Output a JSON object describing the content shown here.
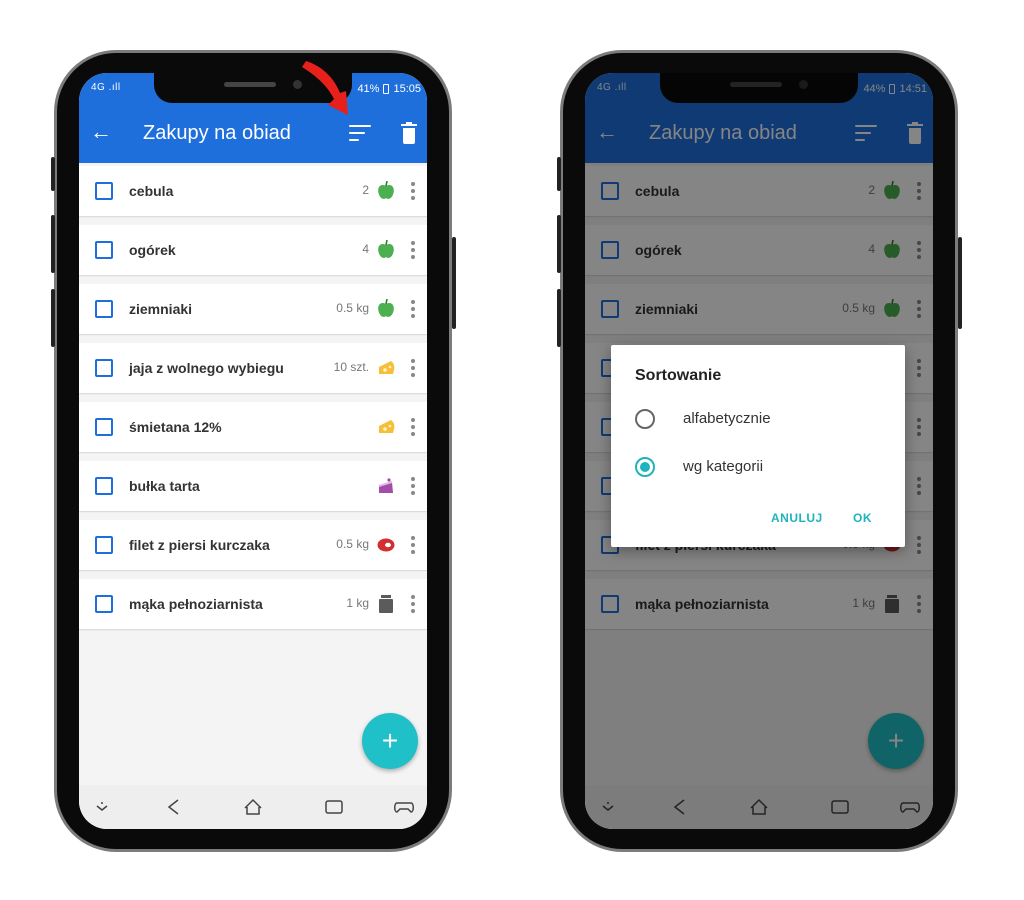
{
  "status_left": {
    "time": "15:05",
    "battery": "41%",
    "network": "4G"
  },
  "status_right": {
    "time": "14:51",
    "battery": "44%",
    "network": "4G"
  },
  "appbar": {
    "title": "Zakupy na obiad"
  },
  "items": [
    {
      "name": "cebula",
      "qty": "2",
      "category": "apple-icon",
      "color": "#4caf50"
    },
    {
      "name": "ogórek",
      "qty": "4",
      "category": "apple-icon",
      "color": "#4caf50"
    },
    {
      "name": "ziemniaki",
      "qty": "0.5 kg",
      "category": "apple-icon",
      "color": "#4caf50"
    },
    {
      "name": "jaja z wolnego wybiegu",
      "qty": "10 szt.",
      "category": "cheese-icon",
      "color": "#f6bf3a"
    },
    {
      "name": "śmietana 12%",
      "qty": "",
      "category": "cheese-icon",
      "color": "#f6bf3a"
    },
    {
      "name": "bułka tarta",
      "qty": "",
      "category": "cake-icon",
      "color": "#a34ca8"
    },
    {
      "name": "filet z piersi kurczaka",
      "qty": "0.5 kg",
      "category": "meat-icon",
      "color": "#d32f2f"
    },
    {
      "name": "mąka pełnoziarnista",
      "qty": "1 kg",
      "category": "jar-icon",
      "color": "#5b5b5b"
    }
  ],
  "dialog": {
    "title": "Sortowanie",
    "options": [
      {
        "label": "alfabetycznie",
        "selected": false
      },
      {
        "label": "wg kategorii",
        "selected": true
      }
    ],
    "cancel_label": "ANULUJ",
    "ok_label": "OK"
  },
  "fab": {
    "label": "+"
  },
  "colors": {
    "primary": "#1e6fdc",
    "accent": "#1fc0c8",
    "pointer": "#e8201c"
  }
}
